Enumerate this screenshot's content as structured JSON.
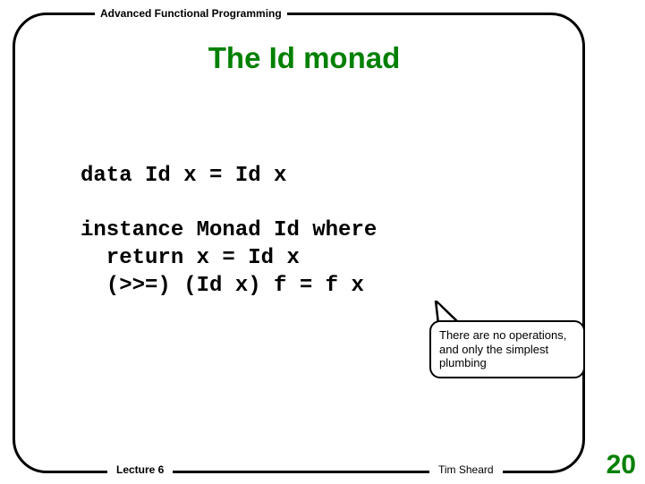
{
  "header": {
    "course": "Advanced Functional Programming"
  },
  "title": "The Id monad",
  "code": "data Id x = Id x\n\ninstance Monad Id where\n  return x = Id x\n  (>>=) (Id x) f = f x",
  "callout": {
    "text": "There are no operations, and only the simplest plumbing"
  },
  "footer": {
    "lecture": "Lecture 6",
    "author": "Tim Sheard"
  },
  "page_number": "20"
}
